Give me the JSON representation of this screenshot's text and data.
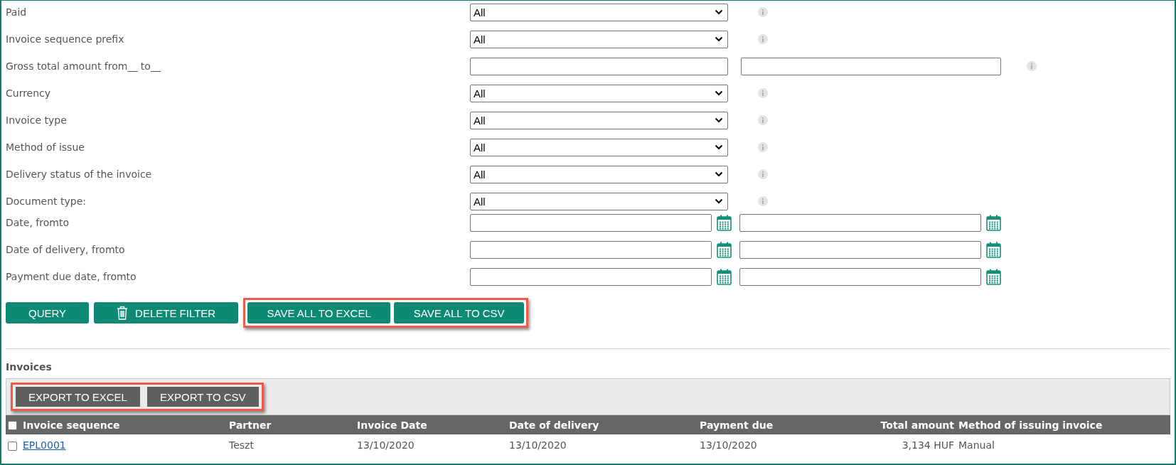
{
  "filters": [
    {
      "label": "Paid",
      "kind": "select",
      "value": "All"
    },
    {
      "label": "Invoice sequence prefix",
      "kind": "select",
      "value": "All"
    },
    {
      "label": "Gross total amount from__ to__",
      "kind": "range"
    },
    {
      "label": "Currency",
      "kind": "select",
      "value": "All"
    },
    {
      "label": "Invoice type",
      "kind": "select",
      "value": "All"
    },
    {
      "label": "Method of issue",
      "kind": "select",
      "value": "All"
    },
    {
      "label": "Delivery status of the invoice",
      "kind": "select",
      "value": "All"
    },
    {
      "label": "Document type:",
      "kind": "select",
      "value": "All"
    },
    {
      "label": "Date, fromto",
      "kind": "date_range"
    },
    {
      "label": "Date of delivery, fromto",
      "kind": "date_range"
    },
    {
      "label": "Payment due date, fromto",
      "kind": "date_range"
    }
  ],
  "filter_buttons": [
    {
      "group": [
        {
          "label": "QUERY",
          "kind": "plain"
        }
      ],
      "highlighted": false
    },
    {
      "group": [
        {
          "label": "DELETE FILTER",
          "kind": "trash"
        }
      ],
      "highlighted": false
    },
    {
      "group": [
        {
          "label": "SAVE ALL TO EXCEL",
          "kind": "plain"
        },
        {
          "label": "SAVE ALL TO CSV",
          "kind": "plain"
        }
      ],
      "highlighted": true
    }
  ],
  "section_title": "Invoices",
  "export_buttons": {
    "highlighted": true,
    "items": [
      "EXPORT TO EXCEL",
      "EXPORT TO CSV"
    ]
  },
  "table": {
    "header_checked": false,
    "columns": [
      "Invoice sequence",
      "Partner",
      "Invoice Date",
      "Date of delivery",
      "Payment due",
      "Total amount",
      "Method of issuing invoice"
    ],
    "rows": [
      {
        "checked": false,
        "cells": [
          "EPL0001",
          "Teszt",
          "13/10/2020",
          "13/10/2020",
          "13/10/2020",
          "3,134 HUF",
          "Manual"
        ]
      }
    ]
  }
}
